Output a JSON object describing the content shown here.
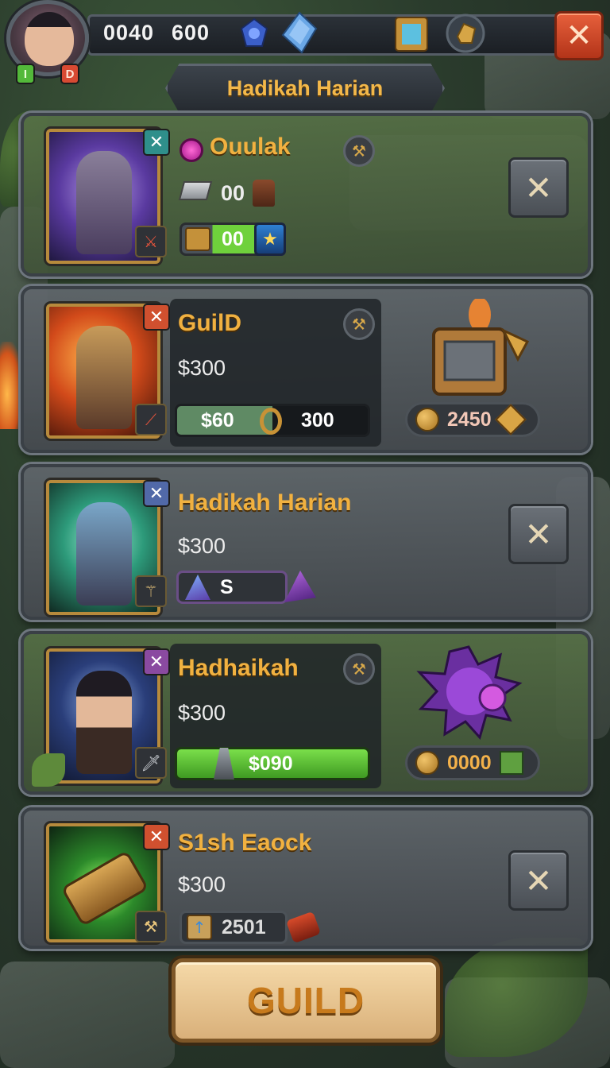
{
  "topbar": {
    "resource_a": "0040",
    "resource_b": "600",
    "level_left": "I",
    "level_right": "D",
    "close_symbol": "✕"
  },
  "title": "Hadikah Harian",
  "cards": [
    {
      "title": "Ouulak",
      "stat_value": "00",
      "progress_label": "00",
      "close_symbol": "✕",
      "corner_badge": "✕"
    },
    {
      "title": "GuilD",
      "price": "$300",
      "bar_left": "$60",
      "bar_right": "300",
      "reward_cost": "2450",
      "corner_badge": "✕"
    },
    {
      "title": "Hadikah Harian",
      "price": "$300",
      "slot_label": "S",
      "close_symbol": "✕",
      "corner_badge": "✕"
    },
    {
      "title": "Hadhaikah",
      "price": "$300",
      "bar_label": "$090",
      "reward_cost": "0000",
      "corner_badge": "✕"
    },
    {
      "title": "S1sh Eaock",
      "price": "$300",
      "slot_label": "2501",
      "close_symbol": "✕",
      "corner_badge": "✕"
    }
  ],
  "bottom_button": "GUILD",
  "colors": {
    "gold_text": "#f1b140",
    "green_bar": "#5fc63a",
    "red_button": "#d8482a"
  },
  "icons": [
    "avatar",
    "sapphire-gem-icon",
    "crystal-icon",
    "blue-cube-icon",
    "gold-ore-icon",
    "close-icon",
    "purple-orb-icon",
    "treasure-chest-icon",
    "spiked-orb-icon",
    "coin-icon"
  ]
}
